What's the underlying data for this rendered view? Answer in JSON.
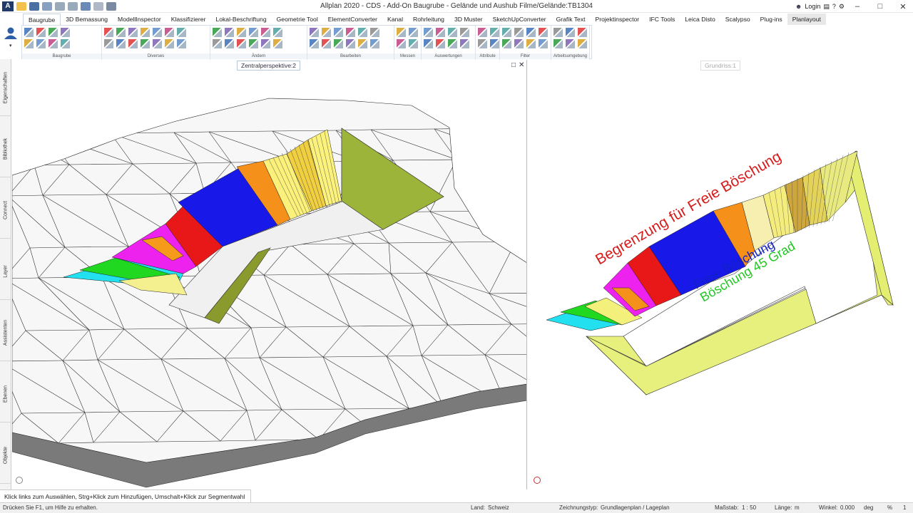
{
  "window": {
    "title": "Allplan 2020 - CDS - Add-On Baugrube - Gelände und Aushub Filme/Gelände:TB1304",
    "logo": "A",
    "login": "Login"
  },
  "tabs": [
    "Baugrube",
    "3D Bemassung",
    "ModellInspector",
    "Klassifizierer",
    "Lokal-Beschriftung",
    "Geometrie Tool",
    "ElementConverter",
    "Kanal",
    "Rohrleitung",
    "3D Muster",
    "SketchUpConverter",
    "Grafik Text",
    "Projektinspector",
    "IFC Tools",
    "Leica Disto",
    "Scalypso",
    "Plug-ins",
    "Planlayout"
  ],
  "ribbon_groups": [
    "Baugrube",
    "Diverses",
    "Ändern",
    "Bearbeiten",
    "Messen",
    "Auswertungen",
    "Attribute",
    "Filter",
    "Arbeitsumgebung"
  ],
  "side_tabs": [
    "Eigenschaften",
    "Bibliothek",
    "Connect",
    "Layer",
    "Assistenten",
    "Ebenen",
    "Objekte"
  ],
  "viewports": {
    "left_title": "Zentralperspektive:2",
    "right_title": "Grundriss:1"
  },
  "annotations": {
    "boundary": "Begrenzung für Freie Böschung",
    "free_slope": "Freie Böschung",
    "slope45": "Böschung 45 Grad"
  },
  "colors": {
    "boundary": "#d81b1b",
    "free_slope": "#1020c8",
    "slope45": "#22c822"
  },
  "prompt": "Klick links zum Auswählen, Strg+Klick zum Hinzufügen, Umschalt+Klick zur Segmentwahl",
  "status": {
    "help": "Drücken Sie F1, um Hilfe zu erhalten.",
    "land_label": "Land:",
    "land_value": "Schweiz",
    "type_label": "Zeichnungstyp:",
    "type_value": "Grundlagenplan / Lageplan",
    "scale_label": "Maßstab:",
    "scale_value": "1 : 50",
    "length_label": "Länge:",
    "length_value": "m",
    "angle_label": "Winkel:",
    "angle_value": "0.000",
    "angle_unit": "deg",
    "percent": "%",
    "percent_value": "1"
  }
}
